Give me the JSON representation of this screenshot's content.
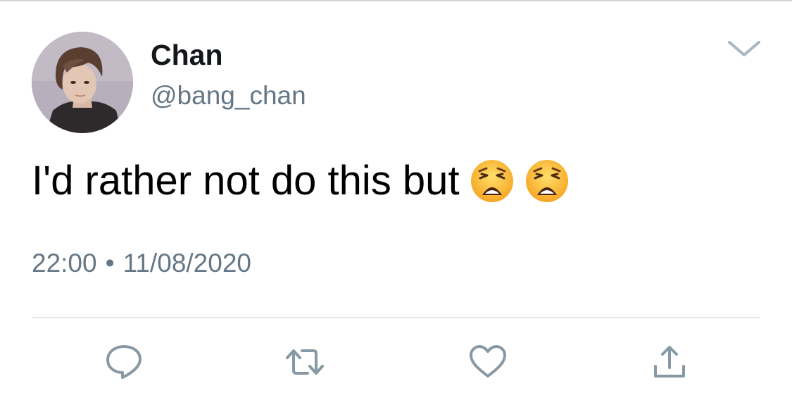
{
  "tweet": {
    "author": {
      "display_name": "Chan",
      "handle": "@bang_chan"
    },
    "text": "I'd rather not do this but",
    "emojis": [
      "weary-face-emoji",
      "weary-face-emoji"
    ],
    "time": "22:00",
    "separator": "•",
    "date": "11/08/2020"
  },
  "actions": {
    "reply_icon": "speech-bubble-icon",
    "retweet_icon": "retweet-arrows-icon",
    "like_icon": "heart-icon",
    "share_icon": "share-upload-icon",
    "more_icon": "chevron-down-icon"
  },
  "colors": {
    "text_primary": "#14171a",
    "text_secondary": "#657786",
    "icon": "#8899a6",
    "divider": "#e1e8ed"
  }
}
